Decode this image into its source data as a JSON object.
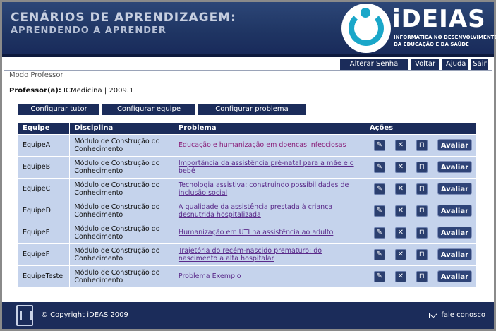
{
  "header": {
    "title_line1": "CENÁRIOS DE APRENDIZAGEM:",
    "title_line2": "APRENDENDO A APRENDER",
    "logo_brand": "iDEIAS",
    "logo_tagline1": "INFORMÁTICA NO DESENVOLVIMENTO",
    "logo_tagline2": "DA EDUCAÇÃO E DA SAÚDE"
  },
  "topnav": {
    "change_password": "Alterar Senha",
    "back": "Voltar",
    "help": "Ajuda",
    "exit": "Sair"
  },
  "mode_label": "Modo Professor",
  "professor": {
    "label": "Professor(a):",
    "value": "ICMedicina | 2009.1"
  },
  "config_buttons": {
    "tutor": "Configurar tutor",
    "team": "Configurar equipe",
    "problem": "Configurar problema"
  },
  "table": {
    "headers": [
      "Equipe",
      "Disciplina",
      "Problema",
      "Ações"
    ],
    "evaluate_label": "Avaliar",
    "rows": [
      {
        "team": "EquipeA",
        "discipline": "Módulo de Construção do Conhecimento",
        "problem": "Educação e humanização em doenças infecciosas"
      },
      {
        "team": "EquipeB",
        "discipline": "Módulo de Construção do Conhecimento",
        "problem": "Importância da assistência pré-natal para a mãe e o bebê"
      },
      {
        "team": "EquipeC",
        "discipline": "Módulo de Construção do Conhecimento",
        "problem": "Tecnologia assistiva: construindo possibilidades de inclusão social"
      },
      {
        "team": "EquipeD",
        "discipline": "Módulo de Construção do Conhecimento",
        "problem": "A qualidade da assistência prestada à criança desnutrida hospitalizada"
      },
      {
        "team": "EquipeE",
        "discipline": "Módulo de Construção do Conhecimento",
        "problem": "Humanização em UTI na assistência ao adulto"
      },
      {
        "team": "EquipeF",
        "discipline": "Módulo de Construção do Conhecimento",
        "problem": "Trajetória do recém-nascido prematuro: do nascimento a alta hospitalar"
      },
      {
        "team": "EquipeTeste",
        "discipline": "Módulo de Construção do Conhecimento",
        "problem": "Problema Exemplo"
      }
    ]
  },
  "footer": {
    "copyright": "© Copyright iDEAS 2009",
    "contact": "fale conosco"
  },
  "colors": {
    "header_bg": "#1f3563",
    "button_bg": "#1b2c5a",
    "row_bg": "#c5d3ec",
    "link": "#5a2a8a",
    "logo_accent": "#1aa7c9"
  }
}
